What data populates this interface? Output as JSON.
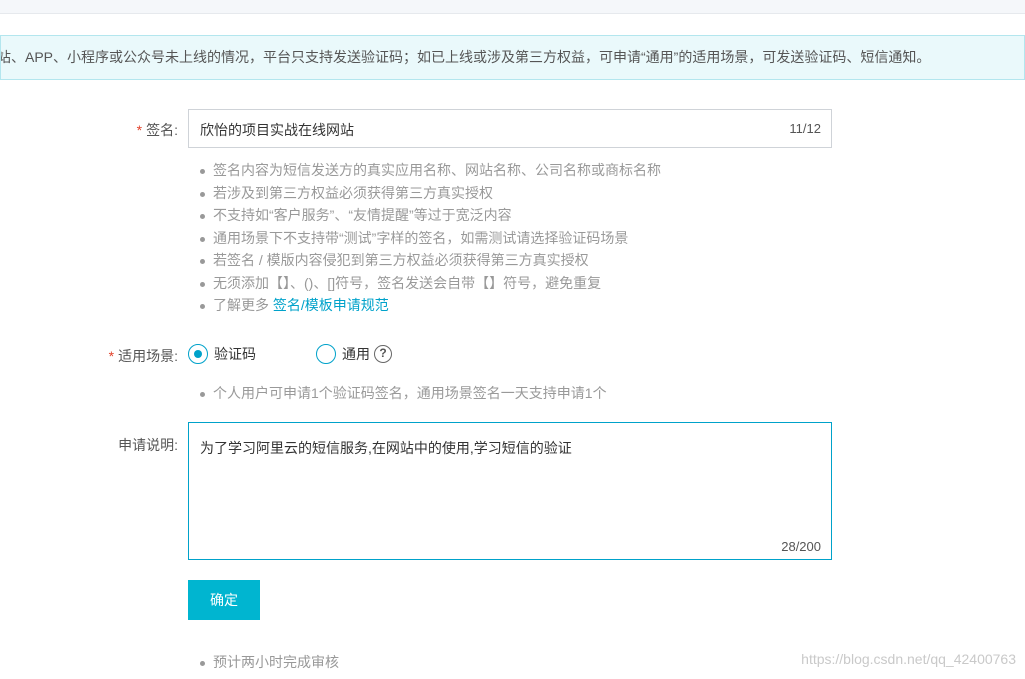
{
  "notice": {
    "text": "站、APP、小程序或公众号未上线的情况，平台只支持发送验证码；如已上线或涉及第三方权益，可申请“通用”的适用场景，可发送验证码、短信通知。"
  },
  "signature": {
    "required_mark": "*",
    "label": "签名:",
    "value": "欣怡的项目实战在线网站",
    "counter": "11/12",
    "tips": [
      "签名内容为短信发送方的真实应用名称、网站名称、公司名称或商标名称",
      "若涉及到第三方权益必须获得第三方真实授权",
      "不支持如“客户服务”、“友情提醒”等过于宽泛内容",
      "通用场景下不支持带“测试”字样的签名，如需测试请选择验证码场景",
      "若签名 / 模版内容侵犯到第三方权益必须获得第三方真实授权",
      "无须添加【】、()、[]符号，签名发送会自带【】符号，避免重复"
    ],
    "more_prefix": "了解更多 ",
    "more_link": "签名/模板申请规范"
  },
  "scenario": {
    "required_mark": "*",
    "label": "适用场景:",
    "options": [
      {
        "label": "验证码",
        "selected": true
      },
      {
        "label": "通用",
        "selected": false
      }
    ],
    "help_icon": "?",
    "tip": "个人用户可申请1个验证码签名，通用场景签名一天支持申请1个"
  },
  "description": {
    "label": "申请说明:",
    "value": "为了学习阿里云的短信服务,在网站中的使用,学习短信的验证",
    "counter": "28/200"
  },
  "submit": {
    "label": "确定"
  },
  "footer_tips": [
    "预计两小时完成审核"
  ],
  "watermark": "https://blog.csdn.net/qq_42400763",
  "colors": {
    "accent": "#00a2ca",
    "button": "#00b5d0",
    "required": "#e2412a",
    "notice_bg": "#eaf9fb"
  }
}
